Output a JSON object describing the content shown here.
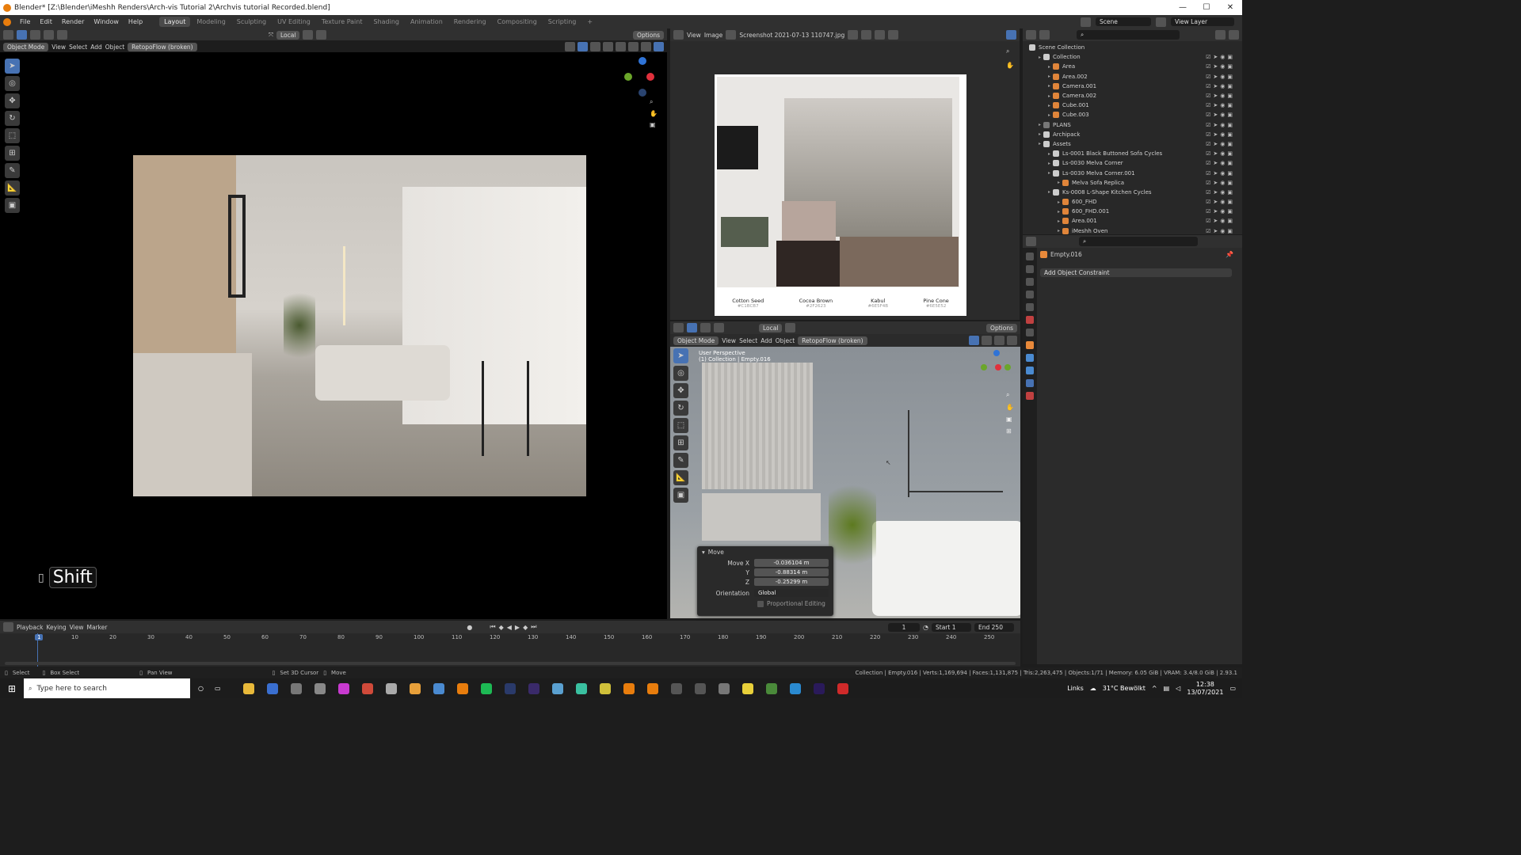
{
  "titlebar": {
    "title": "Blender* [Z:\\Blender\\iMeshh Renders\\Arch-vis Tutorial 2\\Archvis tutorial Recorded.blend]",
    "min": "—",
    "max": "☐",
    "close": "✕"
  },
  "menu": [
    "File",
    "Edit",
    "Render",
    "Window",
    "Help"
  ],
  "workspaces": [
    "Layout",
    "Modeling",
    "Sculpting",
    "UV Editing",
    "Texture Paint",
    "Shading",
    "Animation",
    "Rendering",
    "Compositing",
    "Scripting"
  ],
  "workspace_add": "+",
  "scene": {
    "label": "Scene",
    "view_layer": "View Layer"
  },
  "viewport_main": {
    "mode": "Object Mode",
    "menus": [
      "View",
      "Select",
      "Add",
      "Object"
    ],
    "addon": "RetopoFlow (broken)",
    "transform": "Local",
    "options": "Options",
    "key_overlay": "Shift"
  },
  "image_editor": {
    "menus": [
      "View",
      "Image"
    ],
    "image_name": "Screenshot 2021-07-13 110747.jpg",
    "swatches": [
      {
        "name": "Cotton Seed",
        "hex": "#C1BCB7",
        "color": "#c1bcb7"
      },
      {
        "name": "Cocoa Brown",
        "hex": "#2F2623",
        "color": "#2f2623"
      },
      {
        "name": "Kabul",
        "hex": "#6E5F4B",
        "color": "#6e5f4b"
      },
      {
        "name": "Pine Cone",
        "hex": "#6E5E52",
        "color": "#6e5e52"
      }
    ]
  },
  "viewport_second": {
    "mode": "Object Mode",
    "menus": [
      "View",
      "Select",
      "Add",
      "Object"
    ],
    "addon": "RetopoFlow (broken)",
    "transform": "Local",
    "options": "Options",
    "perspective": "User Perspective",
    "collection_info": "(1) Collection | Empty.016"
  },
  "move_panel": {
    "title": "Move",
    "move_x_label": "Move X",
    "move_x": "-0.036104 m",
    "y_label": "Y",
    "y": "-0.88314 m",
    "z_label": "Z",
    "z": "-0.25299 m",
    "orientation_label": "Orientation",
    "orientation": "Global",
    "proportional": "Proportional Editing"
  },
  "outliner": {
    "title": "Scene Collection",
    "rows": [
      {
        "name": "Collection",
        "indent": 1,
        "color": "#cccccc"
      },
      {
        "name": "Area",
        "indent": 2,
        "color": "#e0853a"
      },
      {
        "name": "Area.002",
        "indent": 2,
        "color": "#e0853a"
      },
      {
        "name": "Camera.001",
        "indent": 2,
        "color": "#e0853a"
      },
      {
        "name": "Camera.002",
        "indent": 2,
        "color": "#e0853a"
      },
      {
        "name": "Cube.001",
        "indent": 2,
        "color": "#e0853a"
      },
      {
        "name": "Cube.003",
        "indent": 2,
        "color": "#e0853a"
      },
      {
        "name": "PLANS",
        "indent": 1,
        "color": "#777777"
      },
      {
        "name": "Archipack",
        "indent": 1,
        "color": "#cccccc"
      },
      {
        "name": "Assets",
        "indent": 1,
        "color": "#cccccc"
      },
      {
        "name": "Ls-0001 Black Buttoned Sofa Cycles",
        "indent": 2,
        "color": "#cccccc"
      },
      {
        "name": "Ls-0030 Melva Corner",
        "indent": 2,
        "color": "#cccccc"
      },
      {
        "name": "Ls-0030 Melva Corner.001",
        "indent": 2,
        "color": "#cccccc"
      },
      {
        "name": "Melva Sofa Replica",
        "indent": 3,
        "color": "#e0853a"
      },
      {
        "name": "Ks-0008 L-Shape Kitchen Cycles",
        "indent": 2,
        "color": "#cccccc"
      },
      {
        "name": "600_FHD",
        "indent": 3,
        "color": "#e0853a"
      },
      {
        "name": "600_FHD.001",
        "indent": 3,
        "color": "#e0853a"
      },
      {
        "name": "Area.001",
        "indent": 3,
        "color": "#e0853a"
      },
      {
        "name": "iMeshh Oven",
        "indent": 3,
        "color": "#e0853a"
      }
    ]
  },
  "properties": {
    "object_name": "Empty.016",
    "add_constraint": "Add Object Constraint"
  },
  "timeline": {
    "menus": [
      "Playback",
      "Keying",
      "View",
      "Marker"
    ],
    "current_frame": "1",
    "start_label": "Start",
    "start": "1",
    "end_label": "End",
    "end": "250",
    "ticks": [
      "1",
      "10",
      "20",
      "30",
      "40",
      "50",
      "60",
      "70",
      "80",
      "90",
      "100",
      "110",
      "120",
      "130",
      "140",
      "150",
      "160",
      "170",
      "180",
      "190",
      "200",
      "210",
      "220",
      "230",
      "240",
      "250"
    ]
  },
  "statusbar": {
    "select": "Select",
    "box_select": "Box Select",
    "pan_view": "Pan View",
    "set_cursor": "Set 3D Cursor",
    "move": "Move",
    "stats": "Collection | Empty.016 | Verts:1,169,694 | Faces:1,131,875 | Tris:2,263,475 | Objects:1/71 | Memory: 6.05 GiB | VRAM: 3.4/8.0 GiB | 2.93.1"
  },
  "taskbar": {
    "search_placeholder": "Type here to search",
    "links": "Links",
    "weather": "31°C Bewölkt",
    "time": "12:38",
    "date": "13/07/2021"
  },
  "colors": {
    "accent": "#4772b3",
    "header": "#303030",
    "panel": "#282828"
  }
}
